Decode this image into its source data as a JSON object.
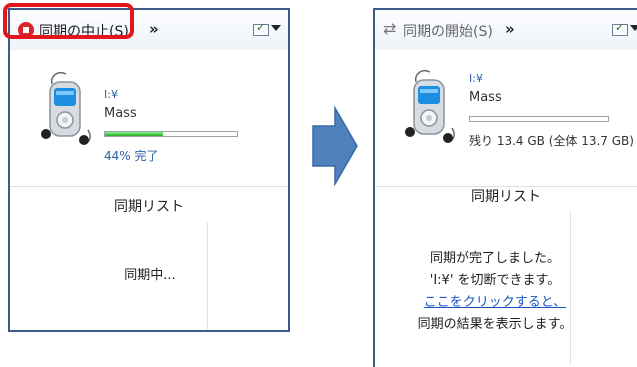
{
  "left_panel": {
    "toolbar": {
      "stop_label": "同期の中止(S)",
      "more_label": "»",
      "options_check": "✓"
    },
    "device": {
      "drive": "I:¥",
      "name": "Mass",
      "progress_percent": 44,
      "status": "44% 完了"
    },
    "sync_list_title": "同期リスト",
    "sync_message": "同期中..."
  },
  "right_panel": {
    "toolbar": {
      "start_label": "同期の開始(S)",
      "more_label": "»",
      "options_check": "✓"
    },
    "device": {
      "drive": "I:¥",
      "name": "Mass",
      "progress_percent": 0,
      "status": "残り 13.4 GB (全体 13.7 GB)"
    },
    "sync_list_title": "同期リスト",
    "complete": {
      "line1": "同期が完了しました。",
      "line2": "'I:¥' を切断できます。",
      "link": "ここをクリックすると、",
      "line4": "同期の結果を表示します。"
    }
  },
  "colors": {
    "highlight": "#e2161d",
    "arrow_fill": "#4f81bd",
    "progress": "#1fae1f",
    "link": "#1a55c4"
  }
}
